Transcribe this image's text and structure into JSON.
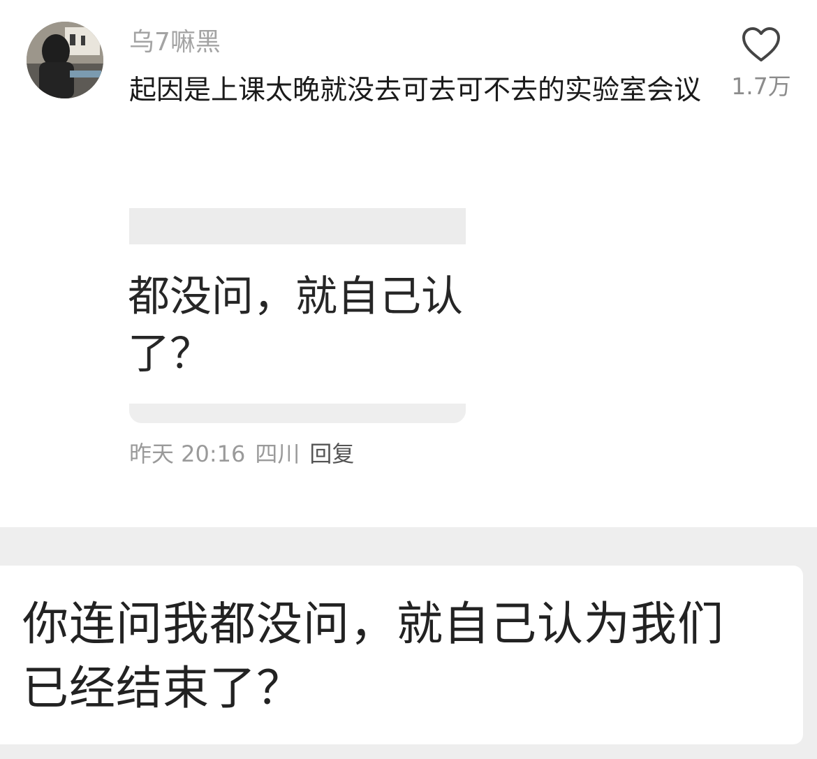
{
  "comment": {
    "username": "乌7嘛黑",
    "text": "起因是上课太晚就没去可去可不去的实验室会议",
    "likes": "1.7万",
    "icon": "heart-outline-icon"
  },
  "image_attachment": {
    "cropped_text": "都没问，就自己认\n了？"
  },
  "meta": {
    "time": "昨天 20:16",
    "location": "四川",
    "reply_label": "回复"
  },
  "zoomed_image": {
    "text": "你连问我都没问，就自己认为我们\n已经结束了？"
  }
}
